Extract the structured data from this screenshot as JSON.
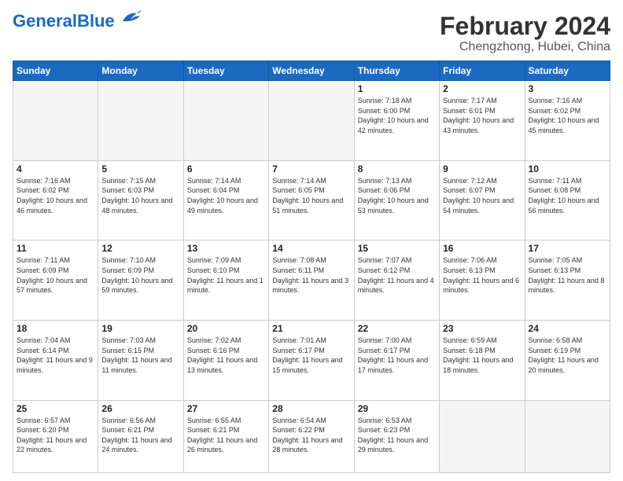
{
  "header": {
    "logo_general": "General",
    "logo_blue": "Blue",
    "month_year": "February 2024",
    "location": "Chengzhong, Hubei, China"
  },
  "weekdays": [
    "Sunday",
    "Monday",
    "Tuesday",
    "Wednesday",
    "Thursday",
    "Friday",
    "Saturday"
  ],
  "weeks": [
    [
      {
        "day": "",
        "info": ""
      },
      {
        "day": "",
        "info": ""
      },
      {
        "day": "",
        "info": ""
      },
      {
        "day": "",
        "info": ""
      },
      {
        "day": "1",
        "info": "Sunrise: 7:18 AM\nSunset: 6:00 PM\nDaylight: 10 hours\nand 42 minutes."
      },
      {
        "day": "2",
        "info": "Sunrise: 7:17 AM\nSunset: 6:01 PM\nDaylight: 10 hours\nand 43 minutes."
      },
      {
        "day": "3",
        "info": "Sunrise: 7:16 AM\nSunset: 6:02 PM\nDaylight: 10 hours\nand 45 minutes."
      }
    ],
    [
      {
        "day": "4",
        "info": "Sunrise: 7:16 AM\nSunset: 6:02 PM\nDaylight: 10 hours\nand 46 minutes."
      },
      {
        "day": "5",
        "info": "Sunrise: 7:15 AM\nSunset: 6:03 PM\nDaylight: 10 hours\nand 48 minutes."
      },
      {
        "day": "6",
        "info": "Sunrise: 7:14 AM\nSunset: 6:04 PM\nDaylight: 10 hours\nand 49 minutes."
      },
      {
        "day": "7",
        "info": "Sunrise: 7:14 AM\nSunset: 6:05 PM\nDaylight: 10 hours\nand 51 minutes."
      },
      {
        "day": "8",
        "info": "Sunrise: 7:13 AM\nSunset: 6:06 PM\nDaylight: 10 hours\nand 53 minutes."
      },
      {
        "day": "9",
        "info": "Sunrise: 7:12 AM\nSunset: 6:07 PM\nDaylight: 10 hours\nand 54 minutes."
      },
      {
        "day": "10",
        "info": "Sunrise: 7:11 AM\nSunset: 6:08 PM\nDaylight: 10 hours\nand 56 minutes."
      }
    ],
    [
      {
        "day": "11",
        "info": "Sunrise: 7:11 AM\nSunset: 6:09 PM\nDaylight: 10 hours\nand 57 minutes."
      },
      {
        "day": "12",
        "info": "Sunrise: 7:10 AM\nSunset: 6:09 PM\nDaylight: 10 hours\nand 59 minutes."
      },
      {
        "day": "13",
        "info": "Sunrise: 7:09 AM\nSunset: 6:10 PM\nDaylight: 11 hours\nand 1 minute."
      },
      {
        "day": "14",
        "info": "Sunrise: 7:08 AM\nSunset: 6:11 PM\nDaylight: 11 hours\nand 3 minutes."
      },
      {
        "day": "15",
        "info": "Sunrise: 7:07 AM\nSunset: 6:12 PM\nDaylight: 11 hours\nand 4 minutes."
      },
      {
        "day": "16",
        "info": "Sunrise: 7:06 AM\nSunset: 6:13 PM\nDaylight: 11 hours\nand 6 minutes."
      },
      {
        "day": "17",
        "info": "Sunrise: 7:05 AM\nSunset: 6:13 PM\nDaylight: 11 hours\nand 8 minutes."
      }
    ],
    [
      {
        "day": "18",
        "info": "Sunrise: 7:04 AM\nSunset: 6:14 PM\nDaylight: 11 hours\nand 9 minutes."
      },
      {
        "day": "19",
        "info": "Sunrise: 7:03 AM\nSunset: 6:15 PM\nDaylight: 11 hours\nand 11 minutes."
      },
      {
        "day": "20",
        "info": "Sunrise: 7:02 AM\nSunset: 6:16 PM\nDaylight: 11 hours\nand 13 minutes."
      },
      {
        "day": "21",
        "info": "Sunrise: 7:01 AM\nSunset: 6:17 PM\nDaylight: 11 hours\nand 15 minutes."
      },
      {
        "day": "22",
        "info": "Sunrise: 7:00 AM\nSunset: 6:17 PM\nDaylight: 11 hours\nand 17 minutes."
      },
      {
        "day": "23",
        "info": "Sunrise: 6:59 AM\nSunset: 6:18 PM\nDaylight: 11 hours\nand 18 minutes."
      },
      {
        "day": "24",
        "info": "Sunrise: 6:58 AM\nSunset: 6:19 PM\nDaylight: 11 hours\nand 20 minutes."
      }
    ],
    [
      {
        "day": "25",
        "info": "Sunrise: 6:57 AM\nSunset: 6:20 PM\nDaylight: 11 hours\nand 22 minutes."
      },
      {
        "day": "26",
        "info": "Sunrise: 6:56 AM\nSunset: 6:21 PM\nDaylight: 11 hours\nand 24 minutes."
      },
      {
        "day": "27",
        "info": "Sunrise: 6:55 AM\nSunset: 6:21 PM\nDaylight: 11 hours\nand 26 minutes."
      },
      {
        "day": "28",
        "info": "Sunrise: 6:54 AM\nSunset: 6:22 PM\nDaylight: 11 hours\nand 28 minutes."
      },
      {
        "day": "29",
        "info": "Sunrise: 6:53 AM\nSunset: 6:23 PM\nDaylight: 11 hours\nand 29 minutes."
      },
      {
        "day": "",
        "info": ""
      },
      {
        "day": "",
        "info": ""
      }
    ]
  ]
}
